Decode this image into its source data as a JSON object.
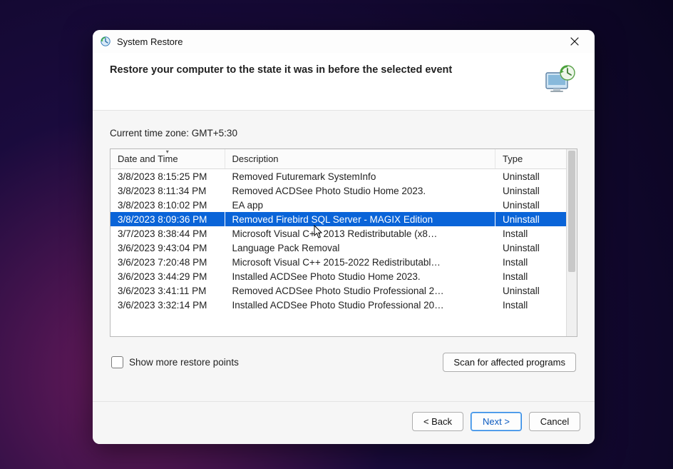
{
  "window": {
    "title": "System Restore"
  },
  "header": {
    "text": "Restore your computer to the state it was in before the selected event"
  },
  "timezone_label": "Current time zone: GMT+5:30",
  "columns": {
    "date": "Date and Time",
    "desc": "Description",
    "type": "Type"
  },
  "rows": [
    {
      "date": "3/8/2023 8:15:25 PM",
      "desc": "Removed Futuremark SystemInfo",
      "type": "Uninstall",
      "selected": false
    },
    {
      "date": "3/8/2023 8:11:34 PM",
      "desc": "Removed ACDSee Photo Studio Home 2023.",
      "type": "Uninstall",
      "selected": false
    },
    {
      "date": "3/8/2023 8:10:02 PM",
      "desc": "EA app",
      "type": "Uninstall",
      "selected": false
    },
    {
      "date": "3/8/2023 8:09:36 PM",
      "desc": "Removed Firebird SQL Server - MAGIX Edition",
      "type": "Uninstall",
      "selected": true
    },
    {
      "date": "3/7/2023 8:38:44 PM",
      "desc": "Microsoft Visual C++ 2013 Redistributable (x8…",
      "type": "Install",
      "selected": false
    },
    {
      "date": "3/6/2023 9:43:04 PM",
      "desc": "Language Pack Removal",
      "type": "Uninstall",
      "selected": false
    },
    {
      "date": "3/6/2023 7:20:48 PM",
      "desc": "Microsoft Visual C++ 2015-2022 Redistributabl…",
      "type": "Install",
      "selected": false
    },
    {
      "date": "3/6/2023 3:44:29 PM",
      "desc": "Installed ACDSee Photo Studio Home 2023.",
      "type": "Install",
      "selected": false
    },
    {
      "date": "3/6/2023 3:41:11 PM",
      "desc": "Removed ACDSee Photo Studio Professional 2…",
      "type": "Uninstall",
      "selected": false
    },
    {
      "date": "3/6/2023 3:32:14 PM",
      "desc": "Installed ACDSee Photo Studio Professional 20…",
      "type": "Install",
      "selected": false
    }
  ],
  "show_more_label": "Show more restore points",
  "buttons": {
    "scan": "Scan for affected programs",
    "back": "< Back",
    "next": "Next >",
    "cancel": "Cancel"
  },
  "icons": {
    "app": "restore-icon",
    "header": "restore-monitor-icon",
    "close": "close-icon",
    "sort": "sort-desc-icon",
    "cursor": "cursor-icon"
  }
}
